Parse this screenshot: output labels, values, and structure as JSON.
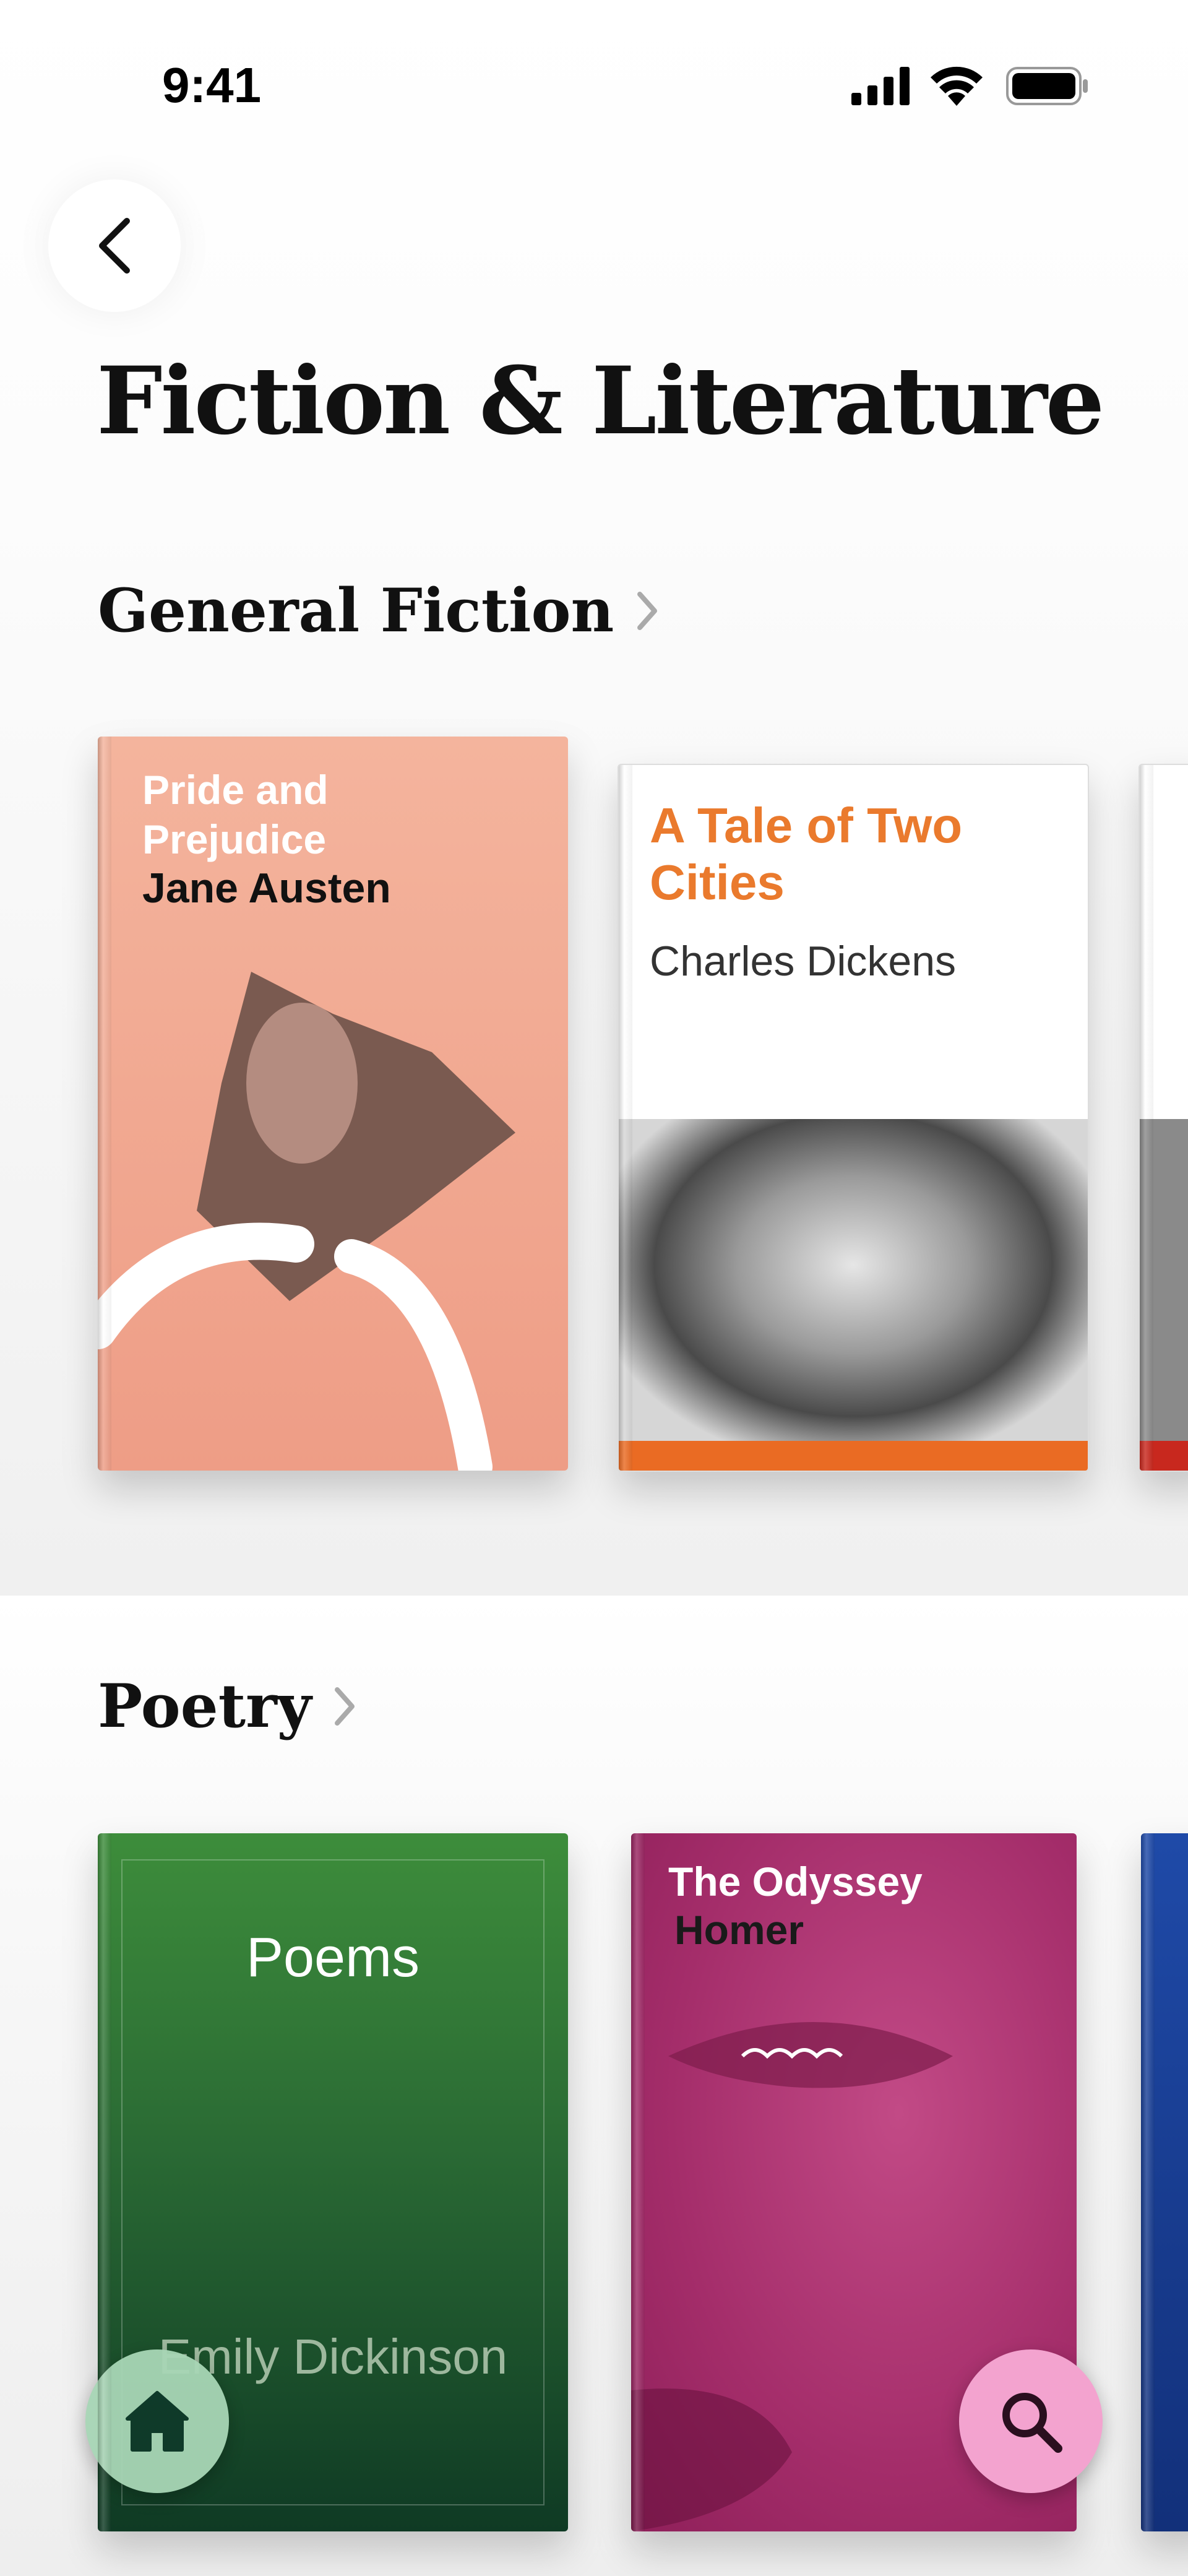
{
  "status_bar": {
    "time": "9:41"
  },
  "header": {
    "title": "Fiction & Literature"
  },
  "sections": [
    {
      "title": "General Fiction",
      "books": [
        {
          "title": "Pride and Prejudice",
          "author": "Jane Austen",
          "color": "#f2a891"
        },
        {
          "title": "A Tale of Two Cities",
          "author": "Charles Dickens",
          "color": "#ea7a2d"
        }
      ]
    },
    {
      "title": "Poetry",
      "books": [
        {
          "title": "Poems",
          "author": "Emily Dickinson",
          "color": "#2f7a36"
        },
        {
          "title": "The Odyssey",
          "author": "Homer",
          "color": "#b03b78"
        }
      ]
    }
  ],
  "nav": {
    "home_icon": "home-icon",
    "search_icon": "search-icon"
  }
}
